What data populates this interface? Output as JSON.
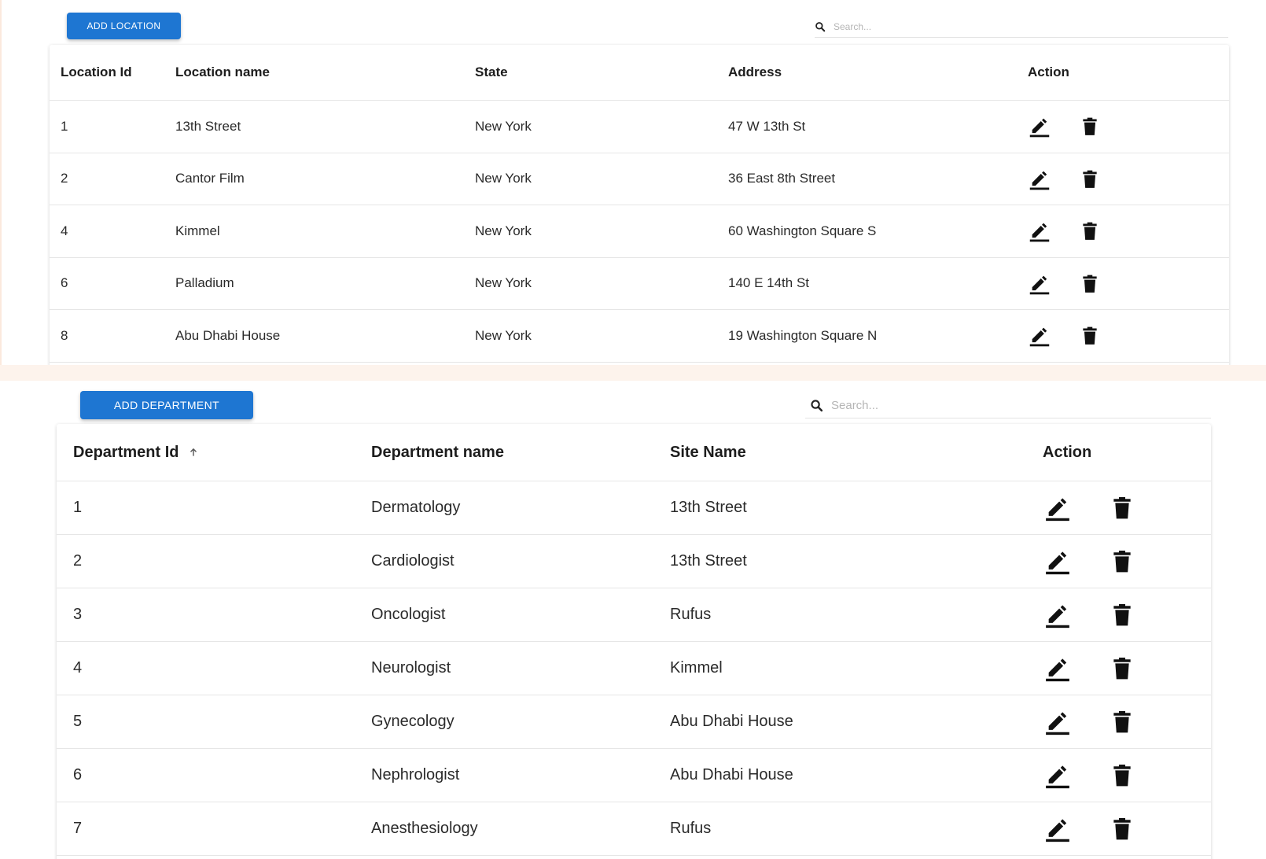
{
  "locations": {
    "add_button": "ADD LOCATION",
    "search_placeholder": "Search...",
    "columns": [
      "Location Id",
      "Location name",
      "State",
      "Address",
      "Action"
    ],
    "rows": [
      {
        "id": "1",
        "name": "13th Street",
        "state": "New York",
        "address": "47 W 13th St"
      },
      {
        "id": "2",
        "name": "Cantor Film",
        "state": "New York",
        "address": "36 East 8th Street"
      },
      {
        "id": "4",
        "name": "Kimmel",
        "state": "New York",
        "address": "60 Washington Square S"
      },
      {
        "id": "6",
        "name": "Palladium",
        "state": "New York",
        "address": "140 E 14th St"
      },
      {
        "id": "8",
        "name": "Abu Dhabi House",
        "state": "New York",
        "address": "19 Washington Square N"
      }
    ]
  },
  "departments": {
    "add_button": "ADD DEPARTMENT",
    "search_placeholder": "Search...",
    "columns": [
      "Department Id",
      "Department name",
      "Site Name",
      "Action"
    ],
    "sort_column": "Department Id",
    "sort_direction": "ascending",
    "rows": [
      {
        "id": "1",
        "name": "Dermatology",
        "site": "13th Street"
      },
      {
        "id": "2",
        "name": "Cardiologist",
        "site": "13th Street"
      },
      {
        "id": "3",
        "name": "Oncologist",
        "site": "Rufus"
      },
      {
        "id": "4",
        "name": "Neurologist",
        "site": "Kimmel"
      },
      {
        "id": "5",
        "name": "Gynecology",
        "site": "Abu Dhabi House"
      },
      {
        "id": "6",
        "name": "Nephrologist",
        "site": "Abu Dhabi House"
      },
      {
        "id": "7",
        "name": "Anesthesiology",
        "site": "Rufus"
      }
    ]
  },
  "icons": {
    "search": "search-icon",
    "edit": "edit-icon",
    "delete": "delete-icon",
    "sort": "arrow-up-icon"
  },
  "colors": {
    "primary_button": "#1e76d2",
    "page_band": "#fdf3ec"
  }
}
